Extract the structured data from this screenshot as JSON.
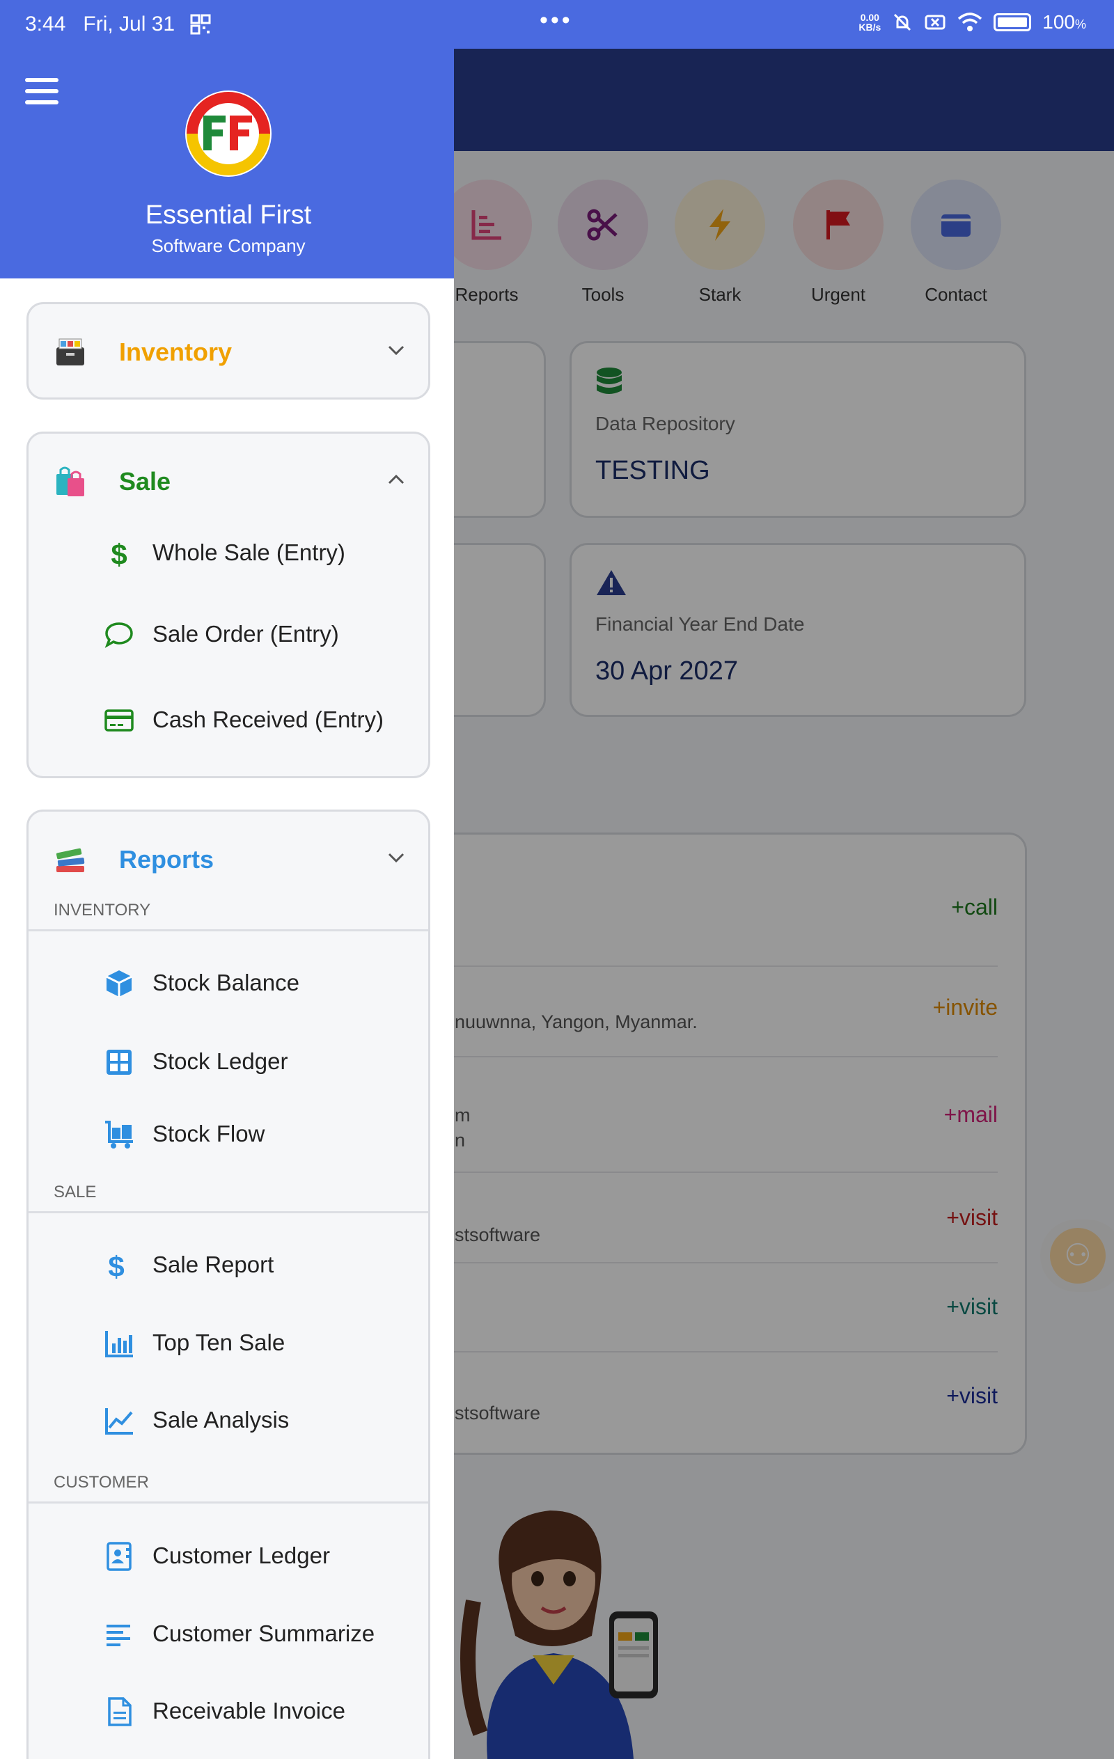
{
  "status_bar": {
    "time": "3:44",
    "date": "Fri, Jul 31",
    "net_speed_top": "0.00",
    "net_speed_bottom": "KB/s",
    "battery": "100",
    "battery_unit": "%"
  },
  "background": {
    "quick_actions": [
      {
        "label": "Reports",
        "icon": "bar-chart-icon",
        "color": "#e0457b"
      },
      {
        "label": "Tools",
        "icon": "scissors-icon",
        "color": "#7a1c7a"
      },
      {
        "label": "Stark",
        "icon": "lightning-icon",
        "color": "#f2a516"
      },
      {
        "label": "Urgent",
        "icon": "flag-icon",
        "color": "#d71920"
      },
      {
        "label": "Contact",
        "icon": "wallet-icon",
        "color": "#4a6ae0"
      }
    ],
    "data_repository": {
      "label": "Data Repository",
      "value": "TESTING"
    },
    "financial_year": {
      "label": "Financial Year End Date",
      "value": "30 Apr 2027"
    },
    "contact_rows": [
      {
        "tag": "+call",
        "text": "",
        "color": "#1f7a1f"
      },
      {
        "tag": "+invite",
        "text": "nuuwnna, Yangon, Myanmar.",
        "color": "#e08a00"
      },
      {
        "tag": "+mail",
        "text": "m",
        "text2": "n",
        "color": "#d4237a"
      },
      {
        "tag": "+visit",
        "text": "stsoftware",
        "color": "#c41e1e"
      },
      {
        "tag": "+visit",
        "text": "",
        "color": "#0f7a6e"
      },
      {
        "tag": "+visit",
        "text": "stsoftware",
        "color": "#1c2e9a"
      }
    ]
  },
  "drawer": {
    "brand_title": "Essential First",
    "brand_subtitle": "Software Company",
    "inventory": {
      "title": "Inventory",
      "color": "#f0a000"
    },
    "sale": {
      "title": "Sale",
      "color": "#1f8a1f",
      "items": [
        {
          "label": "Whole Sale (Entry)",
          "icon": "dollar-icon"
        },
        {
          "label": "Sale Order (Entry)",
          "icon": "chat-bubble-icon"
        },
        {
          "label": "Cash Received (Entry)",
          "icon": "credit-card-icon"
        }
      ]
    },
    "reports": {
      "title": "Reports",
      "color": "#2f8fe0",
      "groups": [
        {
          "heading": "INVENTORY",
          "items": [
            {
              "label": "Stock Balance",
              "icon": "cube-icon"
            },
            {
              "label": "Stock Ledger",
              "icon": "grid-icon"
            },
            {
              "label": "Stock Flow",
              "icon": "trolley-icon"
            }
          ]
        },
        {
          "heading": "SALE",
          "items": [
            {
              "label": "Sale Report",
              "icon": "dollar-icon"
            },
            {
              "label": "Top Ten Sale",
              "icon": "bar-chart-icon"
            },
            {
              "label": "Sale Analysis",
              "icon": "line-chart-icon"
            }
          ]
        },
        {
          "heading": "CUSTOMER",
          "items": [
            {
              "label": "Customer Ledger",
              "icon": "contact-card-icon"
            },
            {
              "label": "Customer Summarize",
              "icon": "list-lines-icon"
            },
            {
              "label": "Receivable Invoice",
              "icon": "document-icon"
            }
          ]
        }
      ]
    }
  }
}
